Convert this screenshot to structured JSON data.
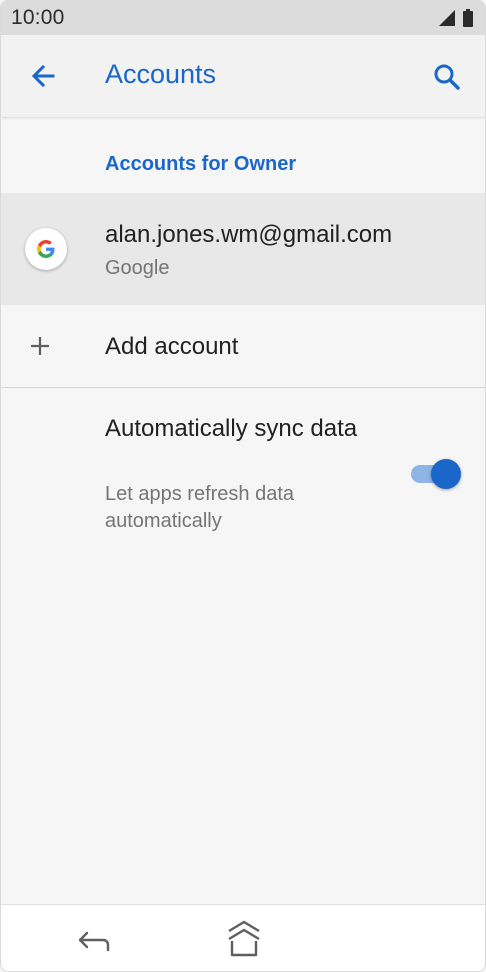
{
  "status_bar": {
    "time": "10:00",
    "icons": [
      "signal-icon",
      "battery-icon"
    ]
  },
  "app_bar": {
    "title": "Accounts",
    "back_icon": "arrow-back-icon",
    "search_icon": "search-icon"
  },
  "section": {
    "header": "Accounts for Owner"
  },
  "account": {
    "email": "alan.jones.wm@gmail.com",
    "type": "Google",
    "icon": "google-logo-icon"
  },
  "add_account": {
    "label": "Add account",
    "icon": "plus-icon"
  },
  "sync": {
    "title": "Automatically sync data",
    "subtitle": "Let apps refresh data automatically",
    "enabled": true
  },
  "nav_bar": {
    "back_icon": "nav-back-icon",
    "home_icon": "nav-home-icon"
  },
  "colors": {
    "accent": "#1a66c9",
    "toggle_track": "#8fb4e6",
    "selected_row": "#e8e8e8",
    "background": "#f6f6f6"
  }
}
